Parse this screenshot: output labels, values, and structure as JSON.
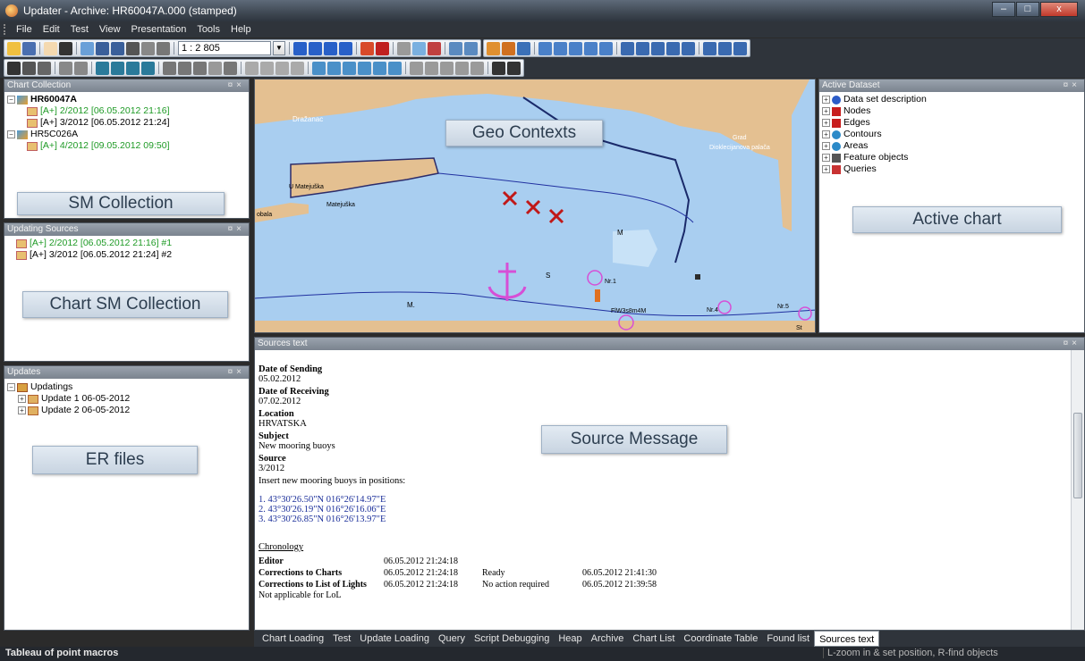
{
  "window": {
    "title": "Updater - Archive: HR60047A.000 (stamped)",
    "min": "–",
    "max": "□",
    "close": "x"
  },
  "menu": [
    "File",
    "Edit",
    "Test",
    "View",
    "Presentation",
    "Tools",
    "Help"
  ],
  "toolbar": {
    "scale_value": "1 : 2 805"
  },
  "panels": {
    "chart_collection": {
      "title": "Chart Collection",
      "items": [
        {
          "label": "HR60047A",
          "level": 0,
          "expanded": true,
          "bold": true,
          "green": false
        },
        {
          "label": "[A+] 2/2012 [06.05.2012 21:16]",
          "level": 1,
          "green": true
        },
        {
          "label": "[A+] 3/2012 [06.05.2012 21:24]",
          "level": 1,
          "green": false
        },
        {
          "label": "HR5C026A",
          "level": 0,
          "expanded": true,
          "bold": false,
          "green": false
        },
        {
          "label": "[A+] 4/2012 [09.05.2012 09:50]",
          "level": 1,
          "green": true
        }
      ],
      "annotation": "SM Collection"
    },
    "updating_sources": {
      "title": "Updating Sources",
      "items": [
        {
          "label": "[A+] 2/2012 [06.05.2012 21:16] #1",
          "green": true
        },
        {
          "label": "[A+] 3/2012 [06.05.2012 21:24] #2",
          "green": false
        }
      ],
      "annotation": "Chart SM Collection"
    },
    "updates": {
      "title": "Updates",
      "root": "Updatings",
      "items": [
        {
          "label": "Update 1  06-05-2012"
        },
        {
          "label": "Update 2  06-05-2012"
        }
      ],
      "annotation": "ER files"
    },
    "active_dataset": {
      "title": "Active Dataset",
      "items": [
        {
          "label": "Data set description",
          "color": "#2c5cc8"
        },
        {
          "label": "Nodes",
          "color": "#c81e1e"
        },
        {
          "label": "Edges",
          "color": "#c81e1e"
        },
        {
          "label": "Contours",
          "color": "#2c8ac8"
        },
        {
          "label": "Areas",
          "color": "#2c8ac8"
        },
        {
          "label": "Feature objects",
          "color": "#555555"
        },
        {
          "label": "Queries",
          "color": "#c83232"
        }
      ],
      "annotation": "Active chart"
    },
    "sources_text": {
      "title": "Sources text",
      "annotation": "Source Message",
      "fields": [
        {
          "heading": "Date of Sending",
          "value": "05.02.2012"
        },
        {
          "heading": "Date of Receiving",
          "value": "07.02.2012"
        },
        {
          "heading": "Location",
          "value": "HRVATSKA"
        },
        {
          "heading": "Subject",
          "value": "New mooring buoys"
        },
        {
          "heading": "Source",
          "value": "3/2012"
        }
      ],
      "instruction": "Insert new mooring buoys in positions:",
      "positions": [
        "1.  43°30'26.50\"N  016°26'14.97\"E",
        "2.  43°30'26.19\"N  016°26'16.06\"E",
        "3.  43°30'26.85\"N  016°26'13.97\"E"
      ],
      "chronology_title": "Chronology",
      "chronology": [
        {
          "label": "Editor",
          "date": "06.05.2012 21:24:18",
          "status": "",
          "date2": ""
        },
        {
          "label": "Corrections to Charts",
          "date": "06.05.2012 21:24:18",
          "status": "Ready",
          "date2": "06.05.2012 21:41:30"
        },
        {
          "label": "Corrections to List of Lights",
          "date": "06.05.2012 21:24:18",
          "status": "No action required",
          "date2": "06.05.2012 21:39:58"
        }
      ],
      "footer": "Not applicable for LoL"
    }
  },
  "map": {
    "annotation": "Geo Contexts",
    "labels": {
      "drazanac": "Dražanac",
      "grad": "Grad",
      "palace": "Dioklecijanova palača",
      "matejuska": "U Matejuška",
      "matejuska2": "Matejuška",
      "obala": "obala",
      "nr1": "Nr.1",
      "nr4": "Nr.4",
      "nr5": "Nr.5",
      "light": "FlW3s8m4M",
      "st": "St",
      "m": "M.",
      "s": "S",
      "m2": "M"
    },
    "colors": {
      "land": "#e4c091",
      "water": "#a9cef0",
      "shallow": "#c8e2f7",
      "buoy": "#d64fd6"
    }
  },
  "tabs": [
    "Chart Loading",
    "Test",
    "Update Loading",
    "Query",
    "Script Debugging",
    "Heap",
    "Archive",
    "Chart List",
    "Coordinate Table",
    "Found list",
    "Sources text"
  ],
  "active_tab": "Sources text",
  "status": {
    "left": "Tableau of point macros",
    "right": "L-zoom in & set position, R-find objects"
  }
}
